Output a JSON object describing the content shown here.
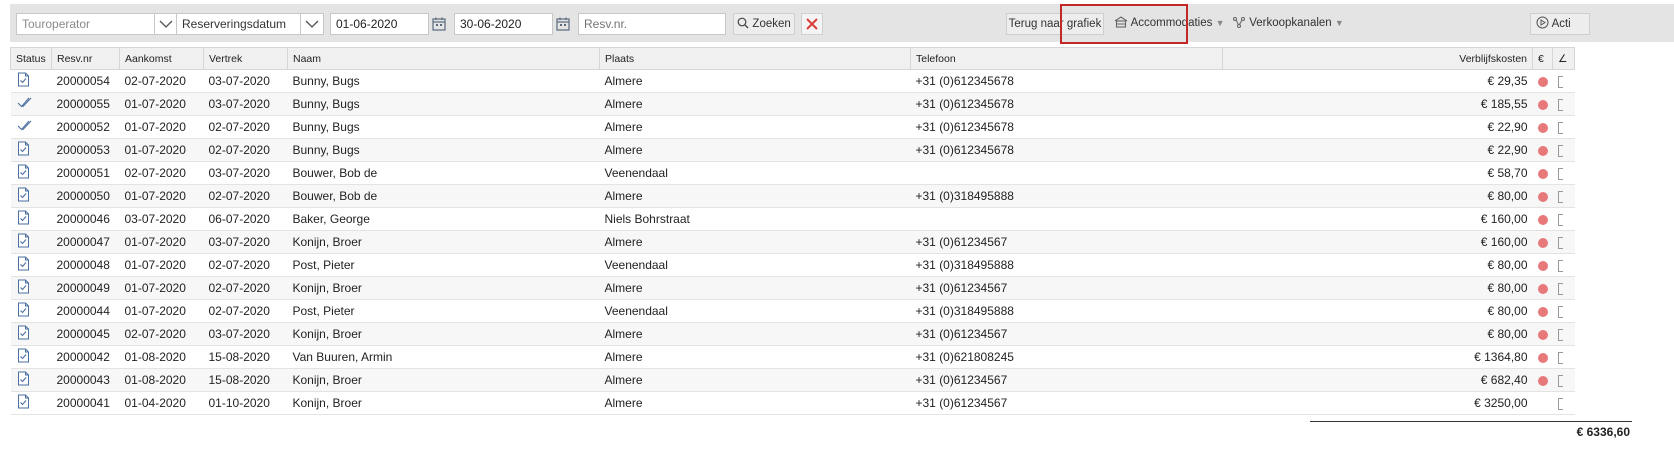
{
  "toolbar": {
    "touroperator": "Touroperator",
    "date_type": "Reserveringsdatum",
    "date_from": "01-06-2020",
    "date_to": "30-06-2020",
    "resv_placeholder": "Resv.nr.",
    "search_label": "Zoeken",
    "back_label": "Terug naar grafiek",
    "accommodations_label": "Accommodaties",
    "channels_label": "Verkoopkanalen",
    "actions_label": "Acti"
  },
  "columns": {
    "status": "Status",
    "resv": "Resv.nr",
    "arrival": "Aankomst",
    "departure": "Vertrek",
    "name": "Naam",
    "place": "Plaats",
    "phone": "Telefoon",
    "cost": "Verblijfskosten",
    "currency": "€",
    "extra": "∠"
  },
  "rows": [
    {
      "status": "doc",
      "resv": "20000054",
      "arrival": "02-07-2020",
      "departure": "03-07-2020",
      "name": "Bunny, Bugs",
      "place": "Almere",
      "phone": "+31 (0)612345678",
      "cost": "€ 29,35",
      "dot": true
    },
    {
      "status": "check",
      "resv": "20000055",
      "arrival": "01-07-2020",
      "departure": "03-07-2020",
      "name": "Bunny, Bugs",
      "place": "Almere",
      "phone": "+31 (0)612345678",
      "cost": "€ 185,55",
      "dot": true
    },
    {
      "status": "check",
      "resv": "20000052",
      "arrival": "01-07-2020",
      "departure": "02-07-2020",
      "name": "Bunny, Bugs",
      "place": "Almere",
      "phone": "+31 (0)612345678",
      "cost": "€ 22,90",
      "dot": true
    },
    {
      "status": "doc",
      "resv": "20000053",
      "arrival": "01-07-2020",
      "departure": "02-07-2020",
      "name": "Bunny, Bugs",
      "place": "Almere",
      "phone": "+31 (0)612345678",
      "cost": "€ 22,90",
      "dot": true
    },
    {
      "status": "doc",
      "resv": "20000051",
      "arrival": "02-07-2020",
      "departure": "03-07-2020",
      "name": "Bouwer, Bob de",
      "place": "Veenendaal",
      "phone": "",
      "cost": "€ 58,70",
      "dot": true
    },
    {
      "status": "doc",
      "resv": "20000050",
      "arrival": "01-07-2020",
      "departure": "02-07-2020",
      "name": "Bouwer, Bob de",
      "place": "Almere",
      "phone": "+31 (0)318495888",
      "cost": "€ 80,00",
      "dot": true
    },
    {
      "status": "doc",
      "resv": "20000046",
      "arrival": "03-07-2020",
      "departure": "06-07-2020",
      "name": "Baker, George",
      "place": "Niels Bohrstraat",
      "phone": "",
      "cost": "€ 160,00",
      "dot": true
    },
    {
      "status": "doc",
      "resv": "20000047",
      "arrival": "01-07-2020",
      "departure": "03-07-2020",
      "name": "Konijn, Broer",
      "place": "Almere",
      "phone": "+31 (0)61234567",
      "cost": "€ 160,00",
      "dot": true
    },
    {
      "status": "doc",
      "resv": "20000048",
      "arrival": "01-07-2020",
      "departure": "02-07-2020",
      "name": "Post, Pieter",
      "place": "Veenendaal",
      "phone": "+31 (0)318495888",
      "cost": "€ 80,00",
      "dot": true
    },
    {
      "status": "doc",
      "resv": "20000049",
      "arrival": "01-07-2020",
      "departure": "02-07-2020",
      "name": "Konijn, Broer",
      "place": "Almere",
      "phone": "+31 (0)61234567",
      "cost": "€ 80,00",
      "dot": true
    },
    {
      "status": "doc",
      "resv": "20000044",
      "arrival": "01-07-2020",
      "departure": "02-07-2020",
      "name": "Post, Pieter",
      "place": "Veenendaal",
      "phone": "+31 (0)318495888",
      "cost": "€ 80,00",
      "dot": true
    },
    {
      "status": "doc",
      "resv": "20000045",
      "arrival": "02-07-2020",
      "departure": "03-07-2020",
      "name": "Konijn, Broer",
      "place": "Almere",
      "phone": "+31 (0)61234567",
      "cost": "€ 80,00",
      "dot": true
    },
    {
      "status": "doc",
      "resv": "20000042",
      "arrival": "01-08-2020",
      "departure": "15-08-2020",
      "name": "Van Buuren, Armin",
      "place": "Almere",
      "phone": "+31 (0)621808245",
      "cost": "€ 1364,80",
      "dot": true
    },
    {
      "status": "doc",
      "resv": "20000043",
      "arrival": "01-08-2020",
      "departure": "15-08-2020",
      "name": "Konijn, Broer",
      "place": "Almere",
      "phone": "+31 (0)61234567",
      "cost": "€ 682,40",
      "dot": true
    },
    {
      "status": "doc",
      "resv": "20000041",
      "arrival": "01-04-2020",
      "departure": "01-10-2020",
      "name": "Konijn, Broer",
      "place": "Almere",
      "phone": "+31 (0)61234567",
      "cost": "€ 3250,00",
      "dot": false
    }
  ],
  "total": "€ 6336,60",
  "colors": {
    "toolbar_bg": "#e4e4e4",
    "highlight": "#c0282a",
    "dot": "#e8797a",
    "close": "#d9403a"
  }
}
